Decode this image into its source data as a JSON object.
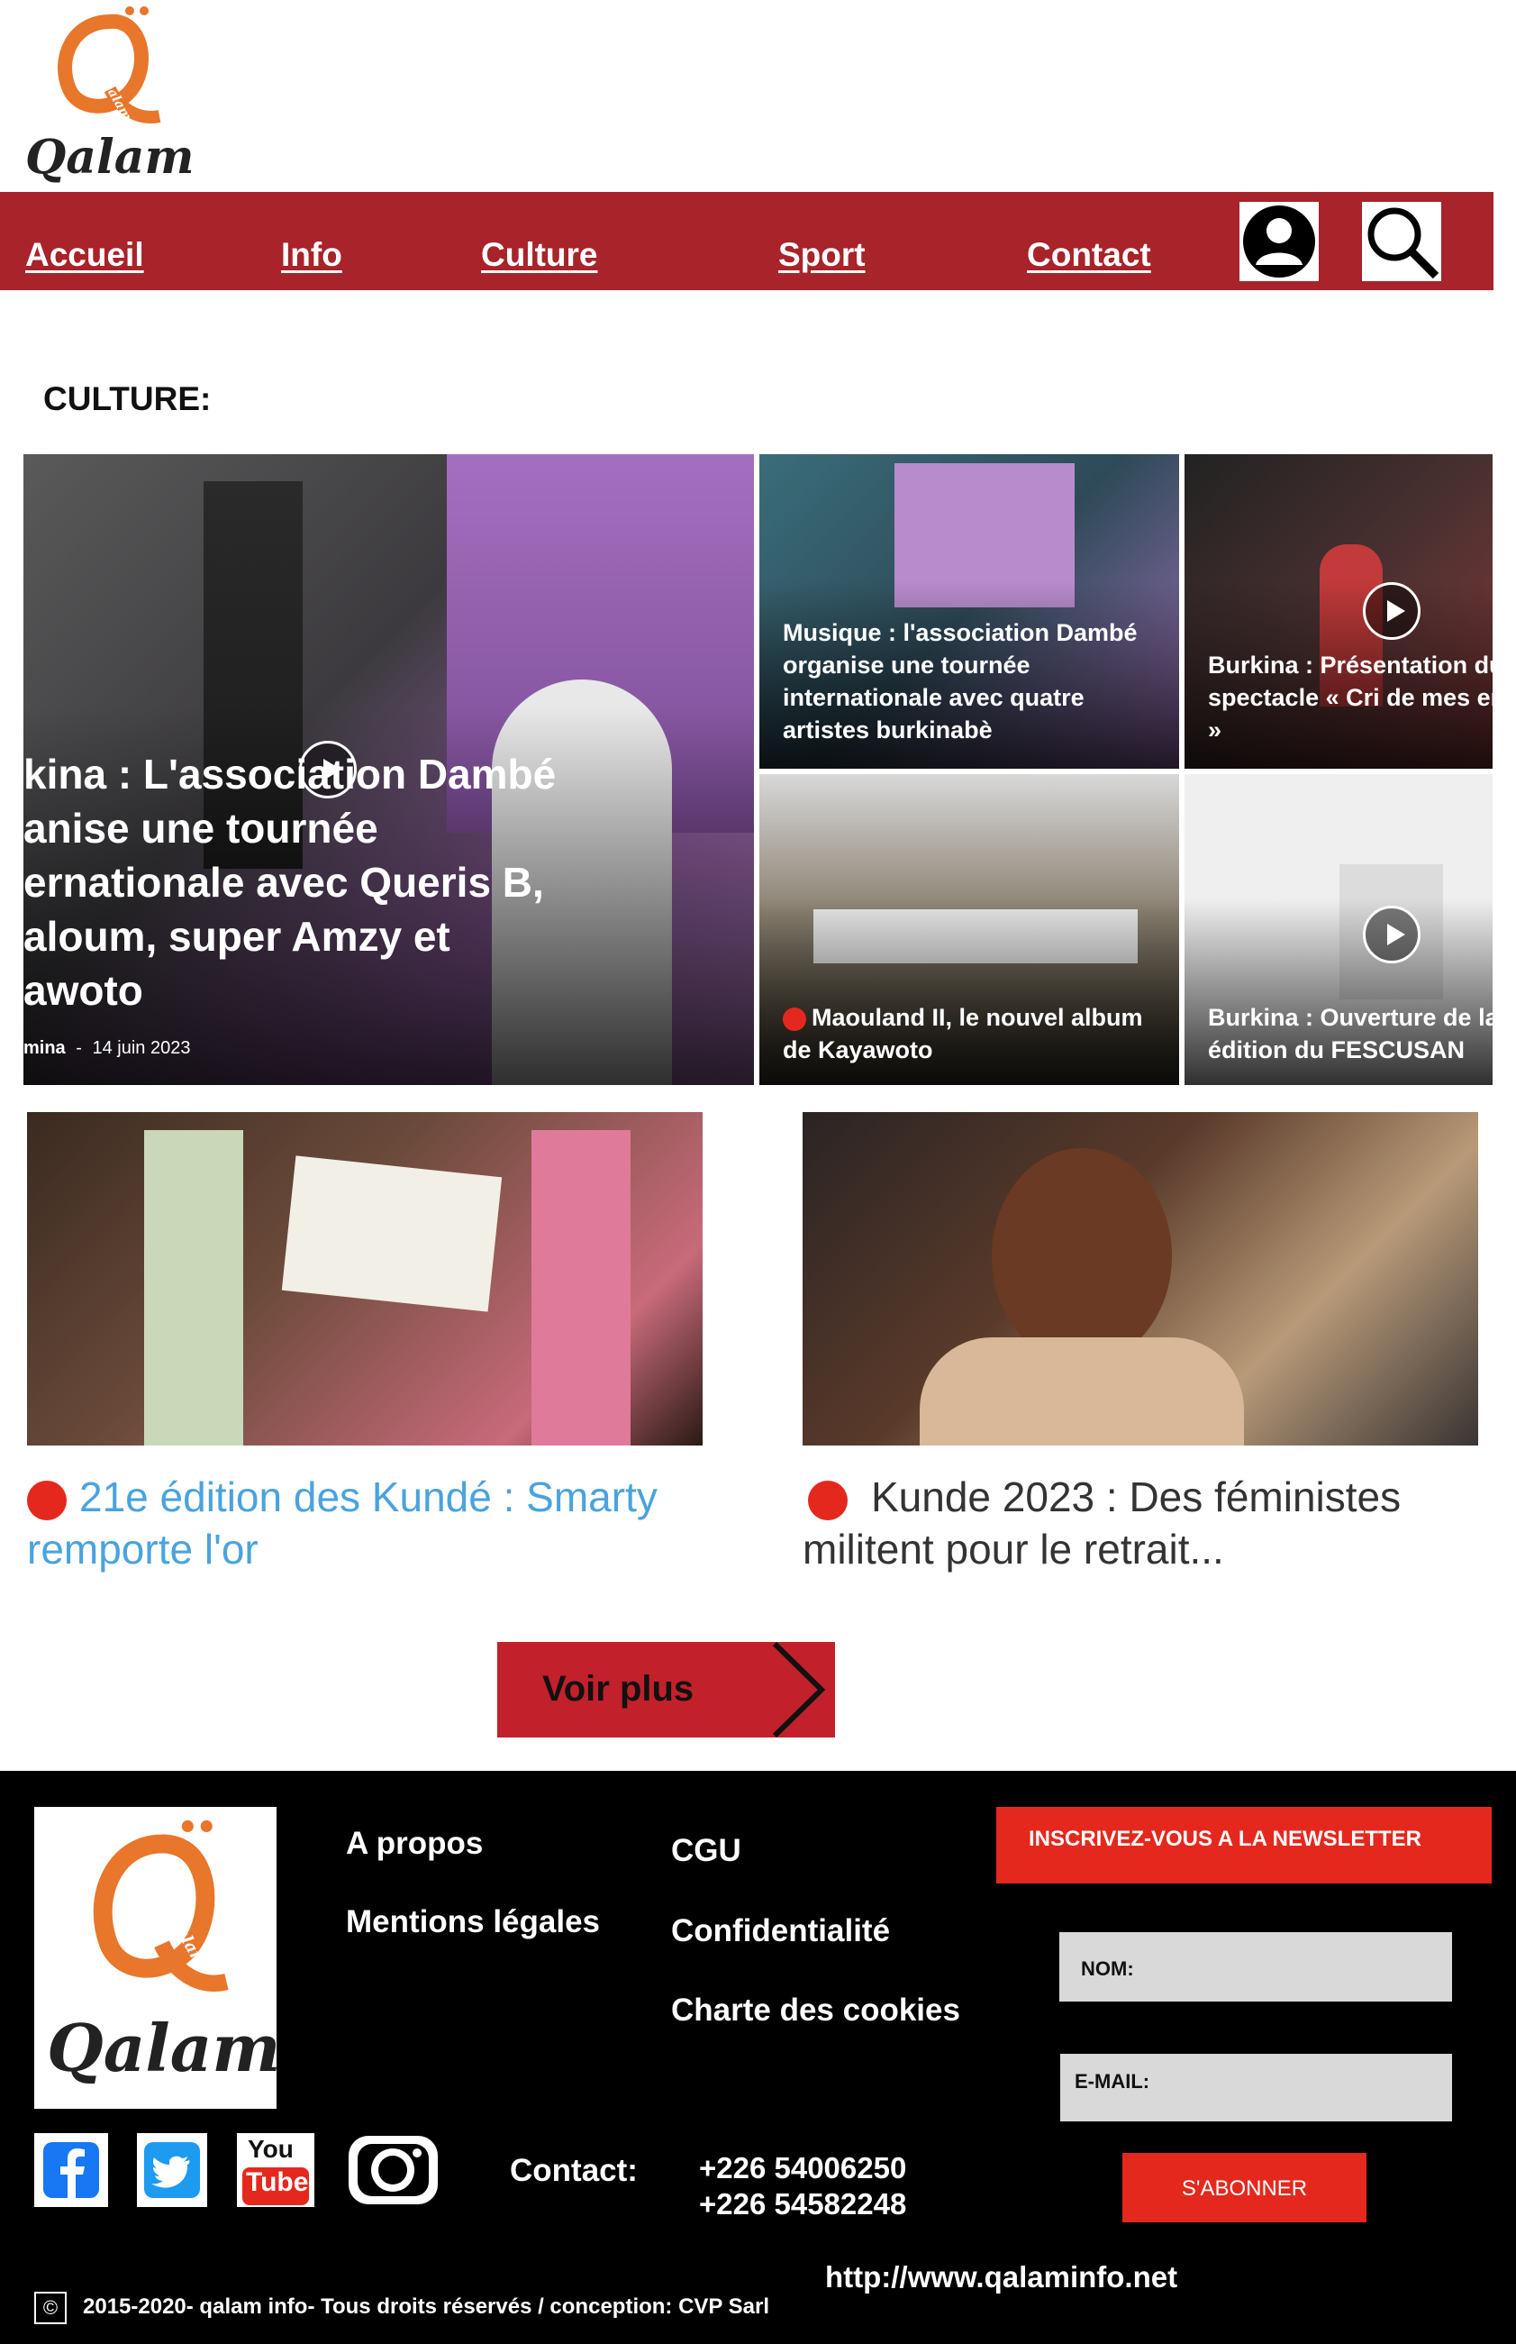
{
  "header": {
    "logo_text": "Qalam",
    "logo_sub": "qalam"
  },
  "nav": {
    "items": [
      "Accueil",
      "Info",
      "Culture",
      "Sport",
      "Contact"
    ],
    "icons": [
      "user-icon",
      "search-icon"
    ]
  },
  "section": {
    "title": "CULTURE:"
  },
  "featured": {
    "main": {
      "title": "Burkina : L'association Dambé organise une tournée internationale avec Queris B, Saloum, super Amzy et Kayawoto",
      "title_lines": [
        "kina : L'association Dambé",
        "anise une tournée",
        "ernationale avec Queris B,",
        "aloum, super Amzy et",
        "awoto"
      ],
      "meta_author": "mina",
      "meta_sep": "-",
      "meta_date": "14 juin 2023"
    },
    "tiles": [
      {
        "lines": [
          "Musique : l'association Dambé",
          "organise une tournée",
          "internationale avec quatre",
          "artistes burkinabè"
        ]
      },
      {
        "lines": [
          "Burkina : Présentation du",
          "spectacle « Cri de mes en",
          "»"
        ]
      },
      {
        "lines": [
          "Maouland II, le nouvel album",
          "de Kayawoto"
        ]
      },
      {
        "lines": [
          "Burkina : Ouverture de la",
          "édition du FESCUSAN"
        ]
      }
    ]
  },
  "cards": [
    {
      "line1": "21e édition des Kundé : Smarty",
      "line2": "remporte l'or",
      "color": "#4aa3df"
    },
    {
      "line1": "Kunde 2023 : Des féministes",
      "line2": "militent pour le retrait...",
      "color": "#333333"
    }
  ],
  "voir_plus": {
    "label": "Voir plus"
  },
  "footer": {
    "logo_text": "Qalam",
    "logo_sub": "qalam",
    "links_col1": [
      "A propos",
      "Mentions légales"
    ],
    "links_col2": [
      "CGU",
      "Confidentialité",
      "Charte des cookies"
    ],
    "newsletter": {
      "title": "INSCRIVEZ-VOUS A LA NEWSLETTER",
      "name_label": "NOM:",
      "email_label": "E-MAIL:",
      "submit_label": "S'ABONNER"
    },
    "social": [
      "facebook-icon",
      "twitter-icon",
      "youtube-icon",
      "instagram-icon"
    ],
    "youtube_text": [
      "You",
      "Tube"
    ],
    "contact_label": "Contact:",
    "phones": [
      "+226 54006250",
      "+226 54582248"
    ],
    "website": "http://www.qalaminfo.net",
    "copyright_symbol": "©",
    "copyright": "2015-2020- qalam info- Tous droits réservés / conception: CVP Sarl"
  },
  "colors": {
    "brand_red": "#a8232a",
    "accent_red": "#e5281d",
    "logo_orange": "#e8762b",
    "link_blue": "#4aa3df"
  }
}
